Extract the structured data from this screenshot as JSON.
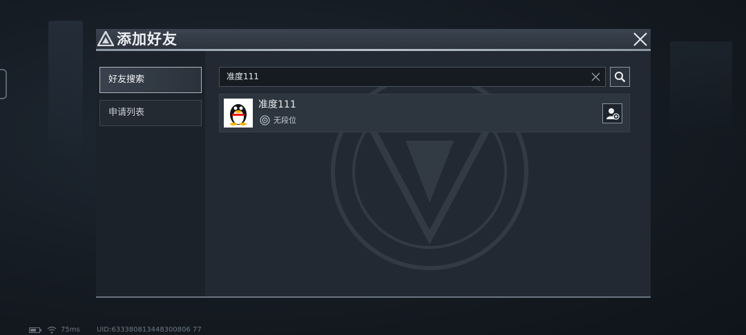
{
  "dialog": {
    "title": "添加好友",
    "icons": {
      "title": "triangle-logo-icon",
      "close": "close-icon"
    }
  },
  "sidebar": {
    "items": [
      {
        "label": "好友搜索",
        "active": true
      },
      {
        "label": "申请列表",
        "active": false
      }
    ]
  },
  "search": {
    "value": "准度111",
    "clear_icon": "clear-icon",
    "button_icon": "search-icon"
  },
  "results": [
    {
      "name": "准度111",
      "rank": "无段位",
      "avatar_icon": "penguin-avatar",
      "rank_icon": "rank-badge-icon",
      "action_icon": "add-friend-icon"
    }
  ],
  "status_bar": {
    "ping": "75ms",
    "uid": "UID:633380813448300806 77"
  },
  "colors": {
    "background": "#151b22",
    "panel": "#222932",
    "accent_border": "#aeb6c0"
  }
}
